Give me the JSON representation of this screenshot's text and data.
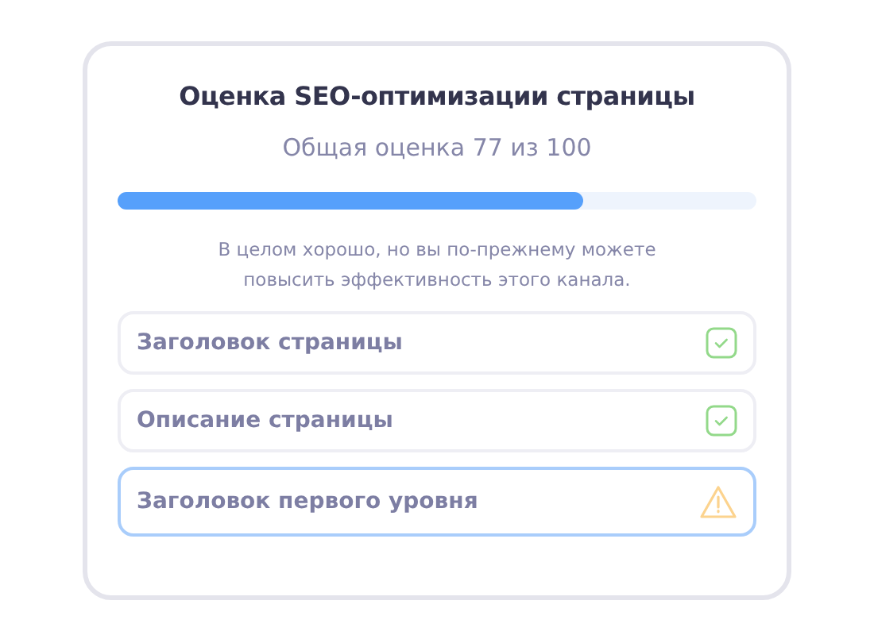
{
  "title": "Оценка SEO-оптимизации страницы",
  "score": "Общая оценка 77 из 100",
  "progress": {
    "level": 0.73
  },
  "message": "В целом хорошо, но вы по-прежнему можете повысить эффективность этого канала.",
  "checks": [
    {
      "label": "Заголовок страницы",
      "kind": "ok",
      "selected": false
    },
    {
      "label": "Описание страницы",
      "kind": "ok",
      "selected": false
    },
    {
      "label": "Заголовок первого уровня",
      "kind": "warning",
      "selected": true
    }
  ]
}
